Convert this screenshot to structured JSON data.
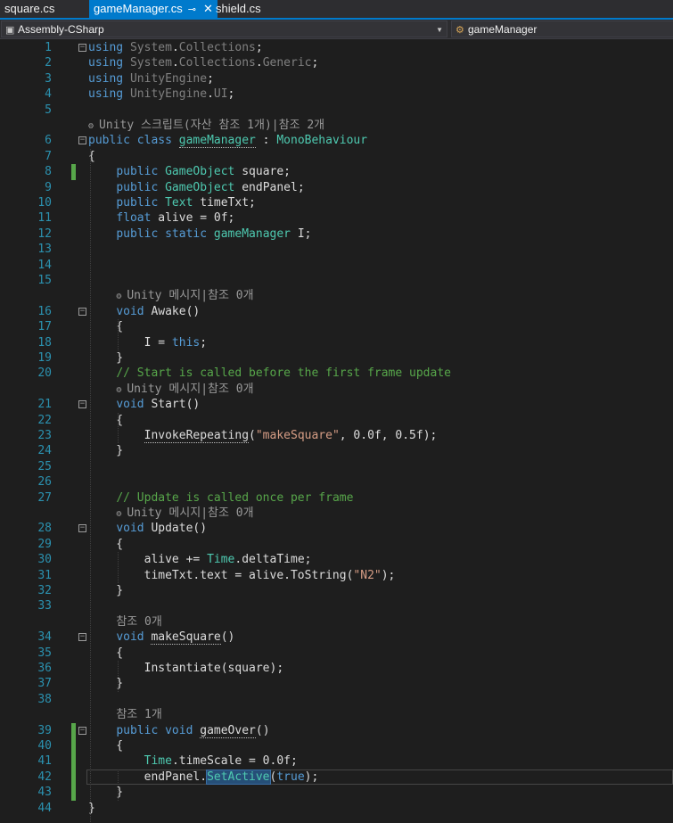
{
  "tabs": [
    {
      "label": "square.cs",
      "active": false
    },
    {
      "label": "gameManager.cs",
      "active": true,
      "pin": "⊸",
      "close": "✕"
    },
    {
      "label": "shield.cs",
      "active": false
    }
  ],
  "nav": {
    "project": "Assembly-CSharp",
    "member": "gameManager"
  },
  "colors": {
    "keyword": "#569cd6",
    "type": "#4ec9b0",
    "string": "#d69d85",
    "comment": "#57a64a",
    "line_number": "#2b91af",
    "accent": "#007acc"
  },
  "icons": {
    "project": "csharp-project-icon",
    "member": "class-icon",
    "lens": "unity-gear-icon"
  },
  "lenses": [
    "Unity 스크립트(자산 참조 1개)|참조 2개",
    "Unity 메시지|참조 0개",
    "Unity 메시지|참조 0개",
    "Unity 메시지|참조 0개",
    "참조 0개",
    "참조 1개"
  ],
  "lines": [
    {
      "n": "1",
      "t": "using System.Collections;"
    },
    {
      "n": "2",
      "t": "using System.Collections.Generic;"
    },
    {
      "n": "3",
      "t": "using UnityEngine;"
    },
    {
      "n": "4",
      "t": "using UnityEngine.UI;"
    },
    {
      "n": "5",
      "t": ""
    },
    {
      "n": "6",
      "t": "public class gameManager : MonoBehaviour"
    },
    {
      "n": "7",
      "t": "{"
    },
    {
      "n": "8",
      "t": "    public GameObject square;"
    },
    {
      "n": "9",
      "t": "    public GameObject endPanel;"
    },
    {
      "n": "10",
      "t": "    public Text timeTxt;"
    },
    {
      "n": "11",
      "t": "    float alive = 0f;"
    },
    {
      "n": "12",
      "t": "    public static gameManager I;"
    },
    {
      "n": "13",
      "t": ""
    },
    {
      "n": "14",
      "t": ""
    },
    {
      "n": "15",
      "t": ""
    },
    {
      "n": "16",
      "t": "    void Awake()"
    },
    {
      "n": "17",
      "t": "    {"
    },
    {
      "n": "18",
      "t": "        I = this;"
    },
    {
      "n": "19",
      "t": "    }"
    },
    {
      "n": "20",
      "t": "    // Start is called before the first frame update"
    },
    {
      "n": "21",
      "t": "    void Start()"
    },
    {
      "n": "22",
      "t": "    {"
    },
    {
      "n": "23",
      "t": "        InvokeRepeating(\"makeSquare\", 0.0f, 0.5f);"
    },
    {
      "n": "24",
      "t": "    }"
    },
    {
      "n": "25",
      "t": ""
    },
    {
      "n": "26",
      "t": ""
    },
    {
      "n": "27",
      "t": "    // Update is called once per frame"
    },
    {
      "n": "28",
      "t": "    void Update()"
    },
    {
      "n": "29",
      "t": "    {"
    },
    {
      "n": "30",
      "t": "        alive += Time.deltaTime;"
    },
    {
      "n": "31",
      "t": "        timeTxt.text = alive.ToString(\"N2\");"
    },
    {
      "n": "32",
      "t": "    }"
    },
    {
      "n": "33",
      "t": ""
    },
    {
      "n": "34",
      "t": "    void makeSquare()"
    },
    {
      "n": "35",
      "t": "    {"
    },
    {
      "n": "36",
      "t": "        Instantiate(square);"
    },
    {
      "n": "37",
      "t": "    }"
    },
    {
      "n": "38",
      "t": ""
    },
    {
      "n": "39",
      "t": "    public void gameOver()"
    },
    {
      "n": "40",
      "t": "    {"
    },
    {
      "n": "41",
      "t": "        Time.timeScale = 0.0f;"
    },
    {
      "n": "42",
      "t": "        endPanel.SetActive(true);"
    },
    {
      "n": "43",
      "t": "    }"
    },
    {
      "n": "44",
      "t": "}"
    }
  ]
}
